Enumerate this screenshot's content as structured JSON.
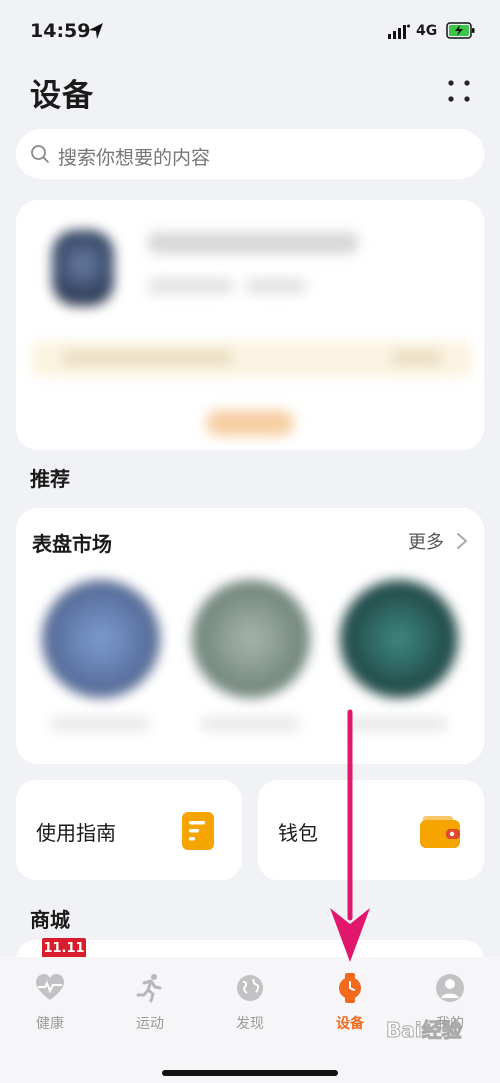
{
  "status_bar": {
    "time": "14:59",
    "network": "4G"
  },
  "header": {
    "title": "设备"
  },
  "search": {
    "placeholder": "搜索你想要的内容"
  },
  "sections": {
    "recommend": "推荐",
    "shop": "商城"
  },
  "dial_market": {
    "title": "表盘市场",
    "more": "更多"
  },
  "tiles": {
    "guide": "使用指南",
    "wallet": "钱包"
  },
  "shop": {
    "promo_badge": "11.11"
  },
  "tab_bar": {
    "items": [
      {
        "label": "健康",
        "icon": "heart-pulse-icon"
      },
      {
        "label": "运动",
        "icon": "running-icon"
      },
      {
        "label": "发现",
        "icon": "globe-icon"
      },
      {
        "label": "设备",
        "icon": "watch-icon",
        "active": true
      },
      {
        "label": "我的",
        "icon": "person-icon"
      }
    ]
  },
  "watermark": {
    "text": "Bai经验"
  },
  "colors": {
    "accent": "#f26b1d",
    "tile_icon": "#f5a400",
    "annotation_arrow": "#e0176b",
    "background": "#f1f2f5"
  }
}
